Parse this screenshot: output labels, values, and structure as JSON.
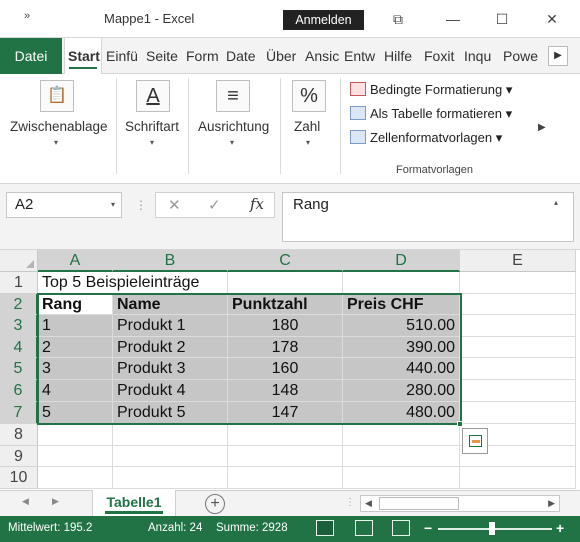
{
  "titlebar": {
    "qa_label": "»",
    "title": "Mappe1  -  Excel",
    "signin": "Anmelden",
    "restore_icon": "⧉",
    "minimize_icon": "—",
    "maximize_icon": "☐",
    "close_icon": "✕"
  },
  "ribbon_tabs": {
    "file": "Datei",
    "items": [
      "Start",
      "Einfü",
      "Seite",
      "Form",
      "Date",
      "Über",
      "Ansic",
      "Entw",
      "Hilfe",
      "Foxit",
      "Inqu",
      "Powe"
    ],
    "scroll_icon": "▶"
  },
  "ribbon": {
    "clipboard": {
      "label": "Zwischenablage",
      "icon": "📋"
    },
    "font": {
      "label": "Schriftart",
      "icon": "A"
    },
    "alignment": {
      "label": "Ausrichtung",
      "icon": "≡"
    },
    "number": {
      "label": "Zahl",
      "icon": "%"
    },
    "styles": {
      "conditional": "Bedingte Formatierung ▾",
      "as_table": "Als Tabelle formatieren ▾",
      "cell_styles": "Zellenformatvorlagen ▾",
      "group_label": "Formatvorlagen"
    },
    "caret": "▾",
    "scroll_icon": "▶"
  },
  "formula_bar": {
    "name_box": "A2",
    "dropdown_icon": "▾",
    "cancel_icon": "✕",
    "enter_icon": "✓",
    "fx_label": "fx",
    "content": "Rang",
    "collapse_icon": "▴"
  },
  "sheet": {
    "columns": [
      "A",
      "B",
      "C",
      "D",
      "E"
    ],
    "rows": [
      "1",
      "2",
      "3",
      "4",
      "5",
      "6",
      "7",
      "8",
      "9",
      "10"
    ],
    "title_cell": "Top 5 Beispieleinträge",
    "headers": [
      "Rang",
      "Name",
      "Punktzahl",
      "Preis CHF"
    ],
    "data": [
      [
        "1",
        "Produkt 1",
        "180",
        "510.00"
      ],
      [
        "2",
        "Produkt 2",
        "178",
        "390.00"
      ],
      [
        "3",
        "Produkt 3",
        "160",
        "440.00"
      ],
      [
        "4",
        "Produkt 4",
        "148",
        "280.00"
      ],
      [
        "5",
        "Produkt 5",
        "147",
        "480.00"
      ]
    ],
    "selected_range": "A2:D7",
    "active_cell": "A2"
  },
  "sheet_tabs": {
    "nav_prev": "◀",
    "nav_next": "▶",
    "active": "Tabelle1",
    "add_icon": "+",
    "hscroll_left": "◀",
    "hscroll_right": "▶"
  },
  "status_bar": {
    "average": "Mittelwert: 195.2",
    "count": "Anzahl: 24",
    "sum": "Summe: 2928",
    "zoom_minus": "−",
    "zoom_plus": "+",
    "zoom_level": 0.55
  },
  "colors": {
    "accent": "#217346",
    "selection_fill": "#c6c6c6"
  }
}
